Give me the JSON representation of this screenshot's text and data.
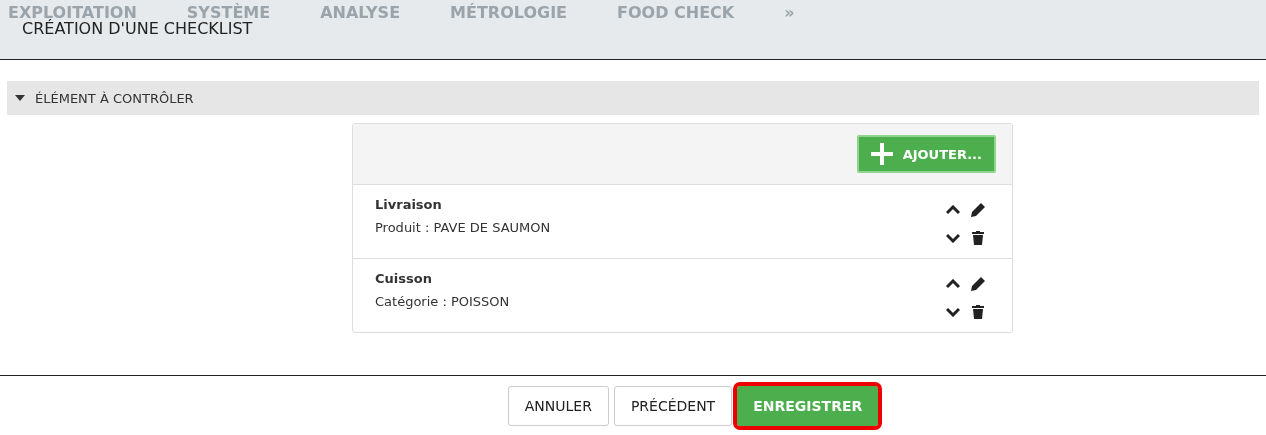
{
  "nav": [
    {
      "label": "EXPLOITATION"
    },
    {
      "label": "SYSTÈME"
    },
    {
      "label": "ANALYSE"
    },
    {
      "label": "MÉTROLOGIE"
    },
    {
      "label": "FOOD CHECK"
    },
    {
      "label": "»"
    }
  ],
  "dialog": {
    "title": "CRÉATION D'UNE CHECKLIST"
  },
  "section": {
    "title": "ÉLÉMENT À CONTRÔLER",
    "expanded": true
  },
  "add_button": "AJOUTER...",
  "items": [
    {
      "name": "Livraison",
      "detail": "Produit : PAVE DE SAUMON"
    },
    {
      "name": "Cuisson",
      "detail": "Catégorie : POISSON"
    }
  ],
  "buttons": [
    {
      "label": "ANNULER",
      "kind": "default",
      "highlighted": false
    },
    {
      "label": "PRÉCÉDENT",
      "kind": "default",
      "highlighted": false
    },
    {
      "label": "ENREGISTRER",
      "kind": "primary",
      "highlighted": true
    }
  ]
}
